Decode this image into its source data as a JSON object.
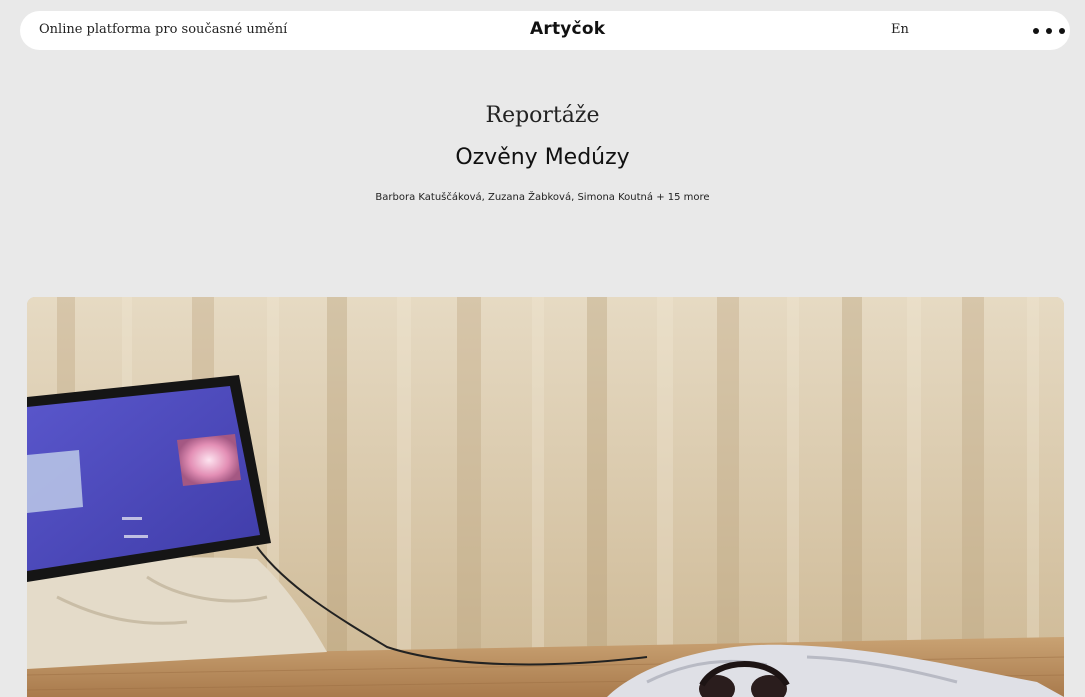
{
  "header": {
    "tagline": "Online platforma pro současné umění",
    "logo": "Artyčok",
    "language": "En",
    "menu_icon": "more-horizontal-icon"
  },
  "article": {
    "category": "Reportáže",
    "title": "Ozvěny Medúzy",
    "authors": "Barbora Katuščáková, Zuzana Žabková, Simona Koutná",
    "more_authors": "+ 15 more"
  },
  "hero": {
    "description_icon": "installation-photo",
    "colors": {
      "curtain": "#d8c8ab",
      "floor": "#c49a6a",
      "screen": "#4b47b8"
    }
  }
}
